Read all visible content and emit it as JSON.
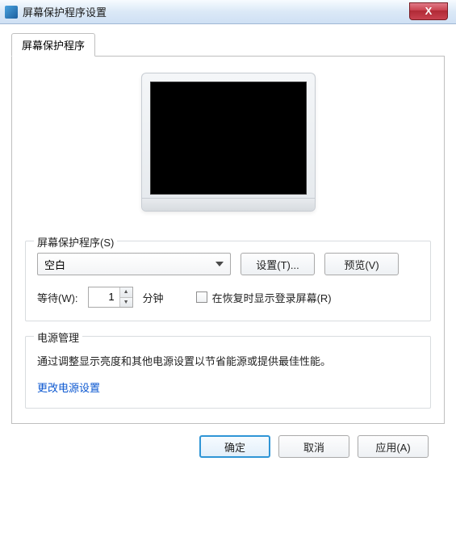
{
  "window": {
    "title": "屏幕保护程序设置",
    "close_label": "X"
  },
  "tab": {
    "label": "屏幕保护程序"
  },
  "screensaver": {
    "group_label": "屏幕保护程序(S)",
    "selected": "空白",
    "settings_btn": "设置(T)...",
    "preview_btn": "预览(V)",
    "wait_label": "等待(W):",
    "wait_value": "1",
    "wait_unit": "分钟",
    "resume_label": "在恢复时显示登录屏幕(R)"
  },
  "power": {
    "group_label": "电源管理",
    "desc": "通过调整显示亮度和其他电源设置以节省能源或提供最佳性能。",
    "link": "更改电源设置"
  },
  "buttons": {
    "ok": "确定",
    "cancel": "取消",
    "apply": "应用(A)"
  }
}
